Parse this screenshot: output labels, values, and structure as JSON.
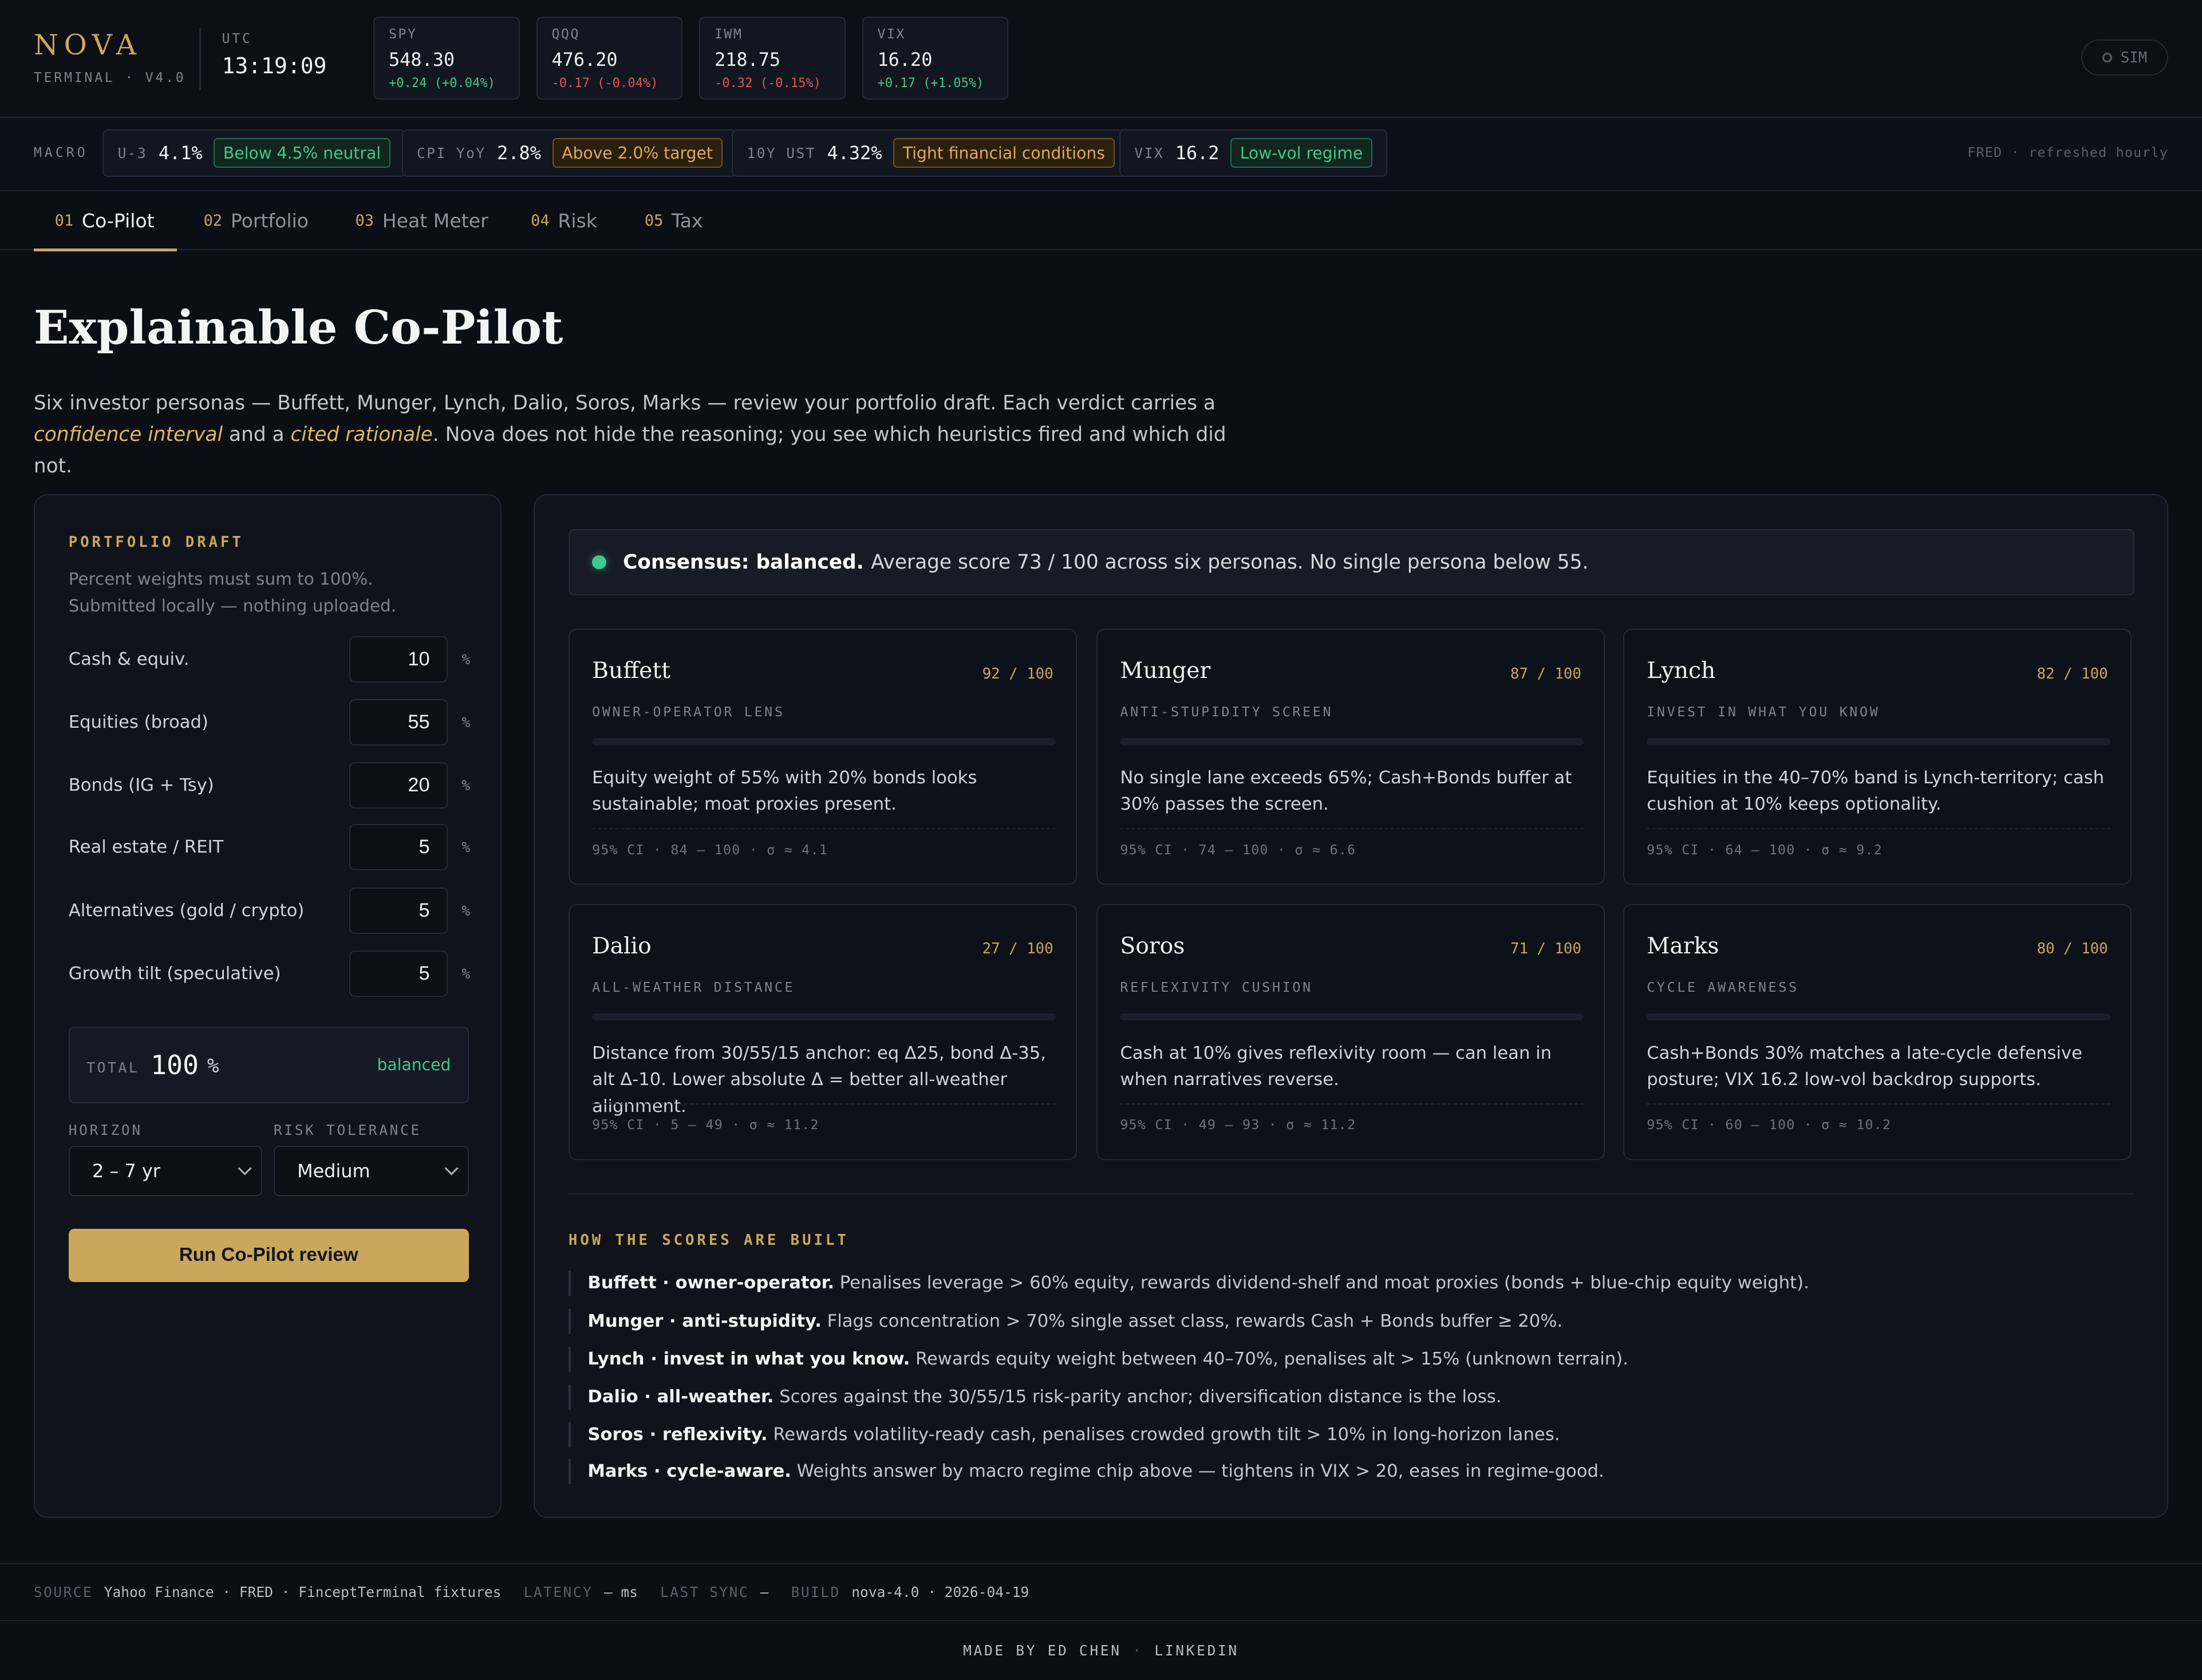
{
  "brand": {
    "name": "NOVA",
    "version": "TERMINAL · V4.0"
  },
  "clock": {
    "label": "UTC",
    "time": "13:19:09"
  },
  "tickers": [
    {
      "symbol": "SPY",
      "price": "548.30",
      "change": "+0.24 (+0.04%)",
      "direction": "up"
    },
    {
      "symbol": "QQQ",
      "price": "476.20",
      "change": "-0.17 (-0.04%)",
      "direction": "down"
    },
    {
      "symbol": "IWM",
      "price": "218.75",
      "change": "-0.32 (-0.15%)",
      "direction": "down"
    },
    {
      "symbol": "VIX",
      "price": "16.20",
      "change": "+0.17 (+1.05%)",
      "direction": "up"
    }
  ],
  "sim_label": "SIM",
  "macro": {
    "label": "MACRO",
    "chips": [
      {
        "key": "U-3",
        "value": "4.1%",
        "badge": "Below 4.5% neutral",
        "tone": "green"
      },
      {
        "key": "CPI YoY",
        "value": "2.8%",
        "badge": "Above 2.0% target",
        "tone": "amber"
      },
      {
        "key": "10Y UST",
        "value": "4.32%",
        "badge": "Tight financial conditions",
        "tone": "amber"
      },
      {
        "key": "VIX",
        "value": "16.2",
        "badge": "Low-vol regime",
        "tone": "green"
      }
    ],
    "source_note": "FRED · refreshed hourly"
  },
  "tabs": [
    {
      "num": "01",
      "label": "Co-Pilot",
      "active": true
    },
    {
      "num": "02",
      "label": "Portfolio",
      "active": false
    },
    {
      "num": "03",
      "label": "Heat Meter",
      "active": false
    },
    {
      "num": "04",
      "label": "Risk",
      "active": false
    },
    {
      "num": "05",
      "label": "Tax",
      "active": false
    }
  ],
  "hero": {
    "title": "Explainable Co-Pilot",
    "desc_1": "Six investor personas — Buffett, Munger, Lynch, Dalio, Soros, Marks — review your portfolio draft. Each verdict carries a ",
    "em_1": "confidence interval",
    "desc_2": " and a ",
    "em_2": "cited rationale",
    "desc_3": ". Nova does not hide the reasoning; you see which heuristics fired and which did not."
  },
  "draft": {
    "title": "PORTFOLIO DRAFT",
    "subtitle": "Percent weights must sum to 100%. Submitted locally — nothing uploaded.",
    "pct": "%",
    "weights": [
      {
        "label": "Cash & equiv.",
        "value": "10"
      },
      {
        "label": "Equities (broad)",
        "value": "55"
      },
      {
        "label": "Bonds (IG + Tsy)",
        "value": "20"
      },
      {
        "label": "Real estate / REIT",
        "value": "5"
      },
      {
        "label": "Alternatives (gold / crypto)",
        "value": "5"
      },
      {
        "label": "Growth tilt (speculative)",
        "value": "5"
      }
    ],
    "total_label": "TOTAL",
    "total_value": "100",
    "total_unit": "%",
    "total_state": "balanced",
    "horizon_label": "HORIZON",
    "horizon_value": "2 – 7 yr",
    "risk_label": "RISK TOLERANCE",
    "risk_value": "Medium",
    "run_label": "Run Co-Pilot review"
  },
  "consensus": {
    "bold": "Consensus: balanced.",
    "text": "Average score 73 / 100 across six personas. No single persona below 55."
  },
  "personas": [
    {
      "name": "Buffett",
      "score": "92 / 100",
      "lens": "OWNER-OPERATOR LENS",
      "text": "Equity weight of 55% with 20% bonds looks sustainable; moat proxies present.",
      "ci": "95% CI · 84 – 100 · σ ≈ 4.1"
    },
    {
      "name": "Munger",
      "score": "87 / 100",
      "lens": "ANTI-STUPIDITY SCREEN",
      "text": "No single lane exceeds 65%; Cash+Bonds buffer at 30% passes the screen.",
      "ci": "95% CI · 74 – 100 · σ ≈ 6.6"
    },
    {
      "name": "Lynch",
      "score": "82 / 100",
      "lens": "INVEST IN WHAT YOU KNOW",
      "text": "Equities in the 40–70% band is Lynch-territory; cash cushion at 10% keeps optionality.",
      "ci": "95% CI · 64 – 100 · σ ≈ 9.2"
    },
    {
      "name": "Dalio",
      "score": "27 / 100",
      "lens": "ALL-WEATHER DISTANCE",
      "text": "Distance from 30/55/15 anchor: eq Δ25, bond Δ-35, alt Δ-10. Lower absolute Δ = better all-weather alignment.",
      "ci": "95% CI · 5 – 49 · σ ≈ 11.2"
    },
    {
      "name": "Soros",
      "score": "71 / 100",
      "lens": "REFLEXIVITY CUSHION",
      "text": "Cash at 10% gives reflexivity room — can lean in when narratives reverse.",
      "ci": "95% CI · 49 – 93 · σ ≈ 11.2"
    },
    {
      "name": "Marks",
      "score": "80 / 100",
      "lens": "CYCLE AWARENESS",
      "text": "Cash+Bonds 30% matches a late-cycle defensive posture; VIX 16.2 low-vol backdrop supports.",
      "ci": "95% CI · 60 – 100 · σ ≈ 10.2"
    }
  ],
  "how": {
    "title": "HOW THE SCORES ARE BUILT",
    "rules": [
      {
        "bold": "Buffett · owner-operator.",
        "text": " Penalises leverage > 60% equity, rewards dividend-shelf and moat proxies (bonds + blue-chip equity weight)."
      },
      {
        "bold": "Munger · anti-stupidity.",
        "text": " Flags concentration > 70% single asset class, rewards Cash + Bonds buffer ≥ 20%."
      },
      {
        "bold": "Lynch · invest in what you know.",
        "text": " Rewards equity weight between 40–70%, penalises alt > 15% (unknown terrain)."
      },
      {
        "bold": "Dalio · all-weather.",
        "text": " Scores against the 30/55/15 risk-parity anchor; diversification distance is the loss."
      },
      {
        "bold": "Soros · reflexivity.",
        "text": " Rewards volatility-ready cash, penalises crowded growth tilt > 10% in long-horizon lanes."
      },
      {
        "bold": "Marks · cycle-aware.",
        "text": " Weights answer by macro regime chip above — tightens in VIX > 20, eases in regime-good."
      }
    ]
  },
  "footer": {
    "source_label": "SOURCE",
    "source_value": "Yahoo Finance · FRED · FinceptTerminal fixtures",
    "latency_label": "LATENCY",
    "latency_value": "— ms",
    "sync_label": "LAST SYNC",
    "sync_value": "—",
    "build_label": "BUILD",
    "build_value": "nova-4.0 · 2026-04-19"
  },
  "madeby": {
    "text": "MADE BY ED CHEN",
    "sep": "·",
    "link": "LINKEDIN"
  },
  "colors": {
    "accent": "#c9a85c",
    "up": "#3fc98b",
    "down": "#e2545a",
    "background": "#0b0e15"
  }
}
